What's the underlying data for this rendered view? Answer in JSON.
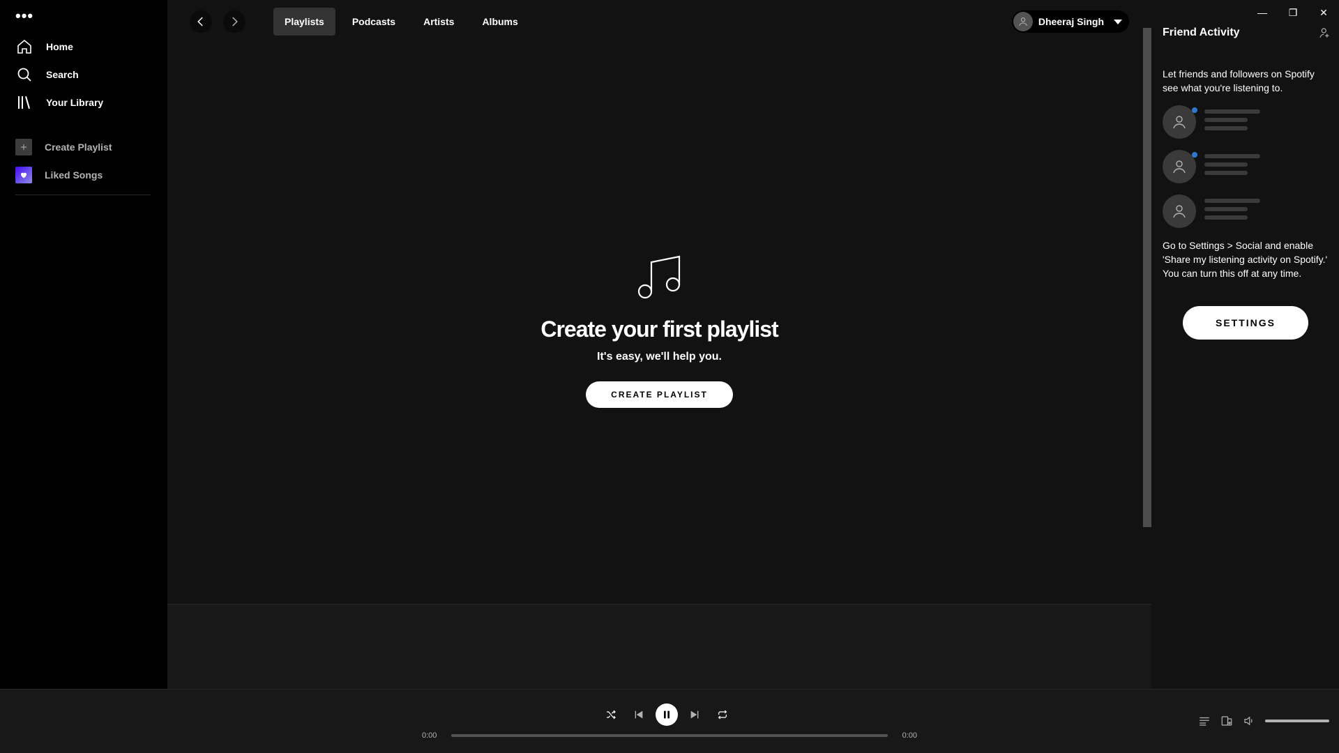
{
  "sidebar": {
    "menu_dots": "•••",
    "items": [
      {
        "label": "Home",
        "icon": "home-icon"
      },
      {
        "label": "Search",
        "icon": "search-icon"
      },
      {
        "label": "Your Library",
        "icon": "library-icon"
      }
    ],
    "create_playlist": "Create Playlist",
    "liked_songs": "Liked Songs"
  },
  "topbar": {
    "tabs": [
      "Playlists",
      "Podcasts",
      "Artists",
      "Albums"
    ],
    "active_tab": "Playlists",
    "user_name": "Dheeraj Singh"
  },
  "empty_state": {
    "title": "Create your first playlist",
    "subtitle": "It's easy, we'll help you.",
    "button": "CREATE PLAYLIST"
  },
  "friend_activity": {
    "title": "Friend Activity",
    "intro": "Let friends and followers on Spotify see what you're listening to.",
    "hint": "Go to Settings > Social and enable 'Share my listening activity on Spotify.' You can turn this off at any time.",
    "settings_button": "SETTINGS"
  },
  "player": {
    "elapsed": "0:00",
    "duration": "0:00",
    "progress_fraction": 0,
    "volume_fraction": 1.0
  },
  "colors": {
    "background": "#000000",
    "main_bg": "#121212",
    "accent_blue": "#2e77d0",
    "liked_gradient_start": "#450af5"
  }
}
